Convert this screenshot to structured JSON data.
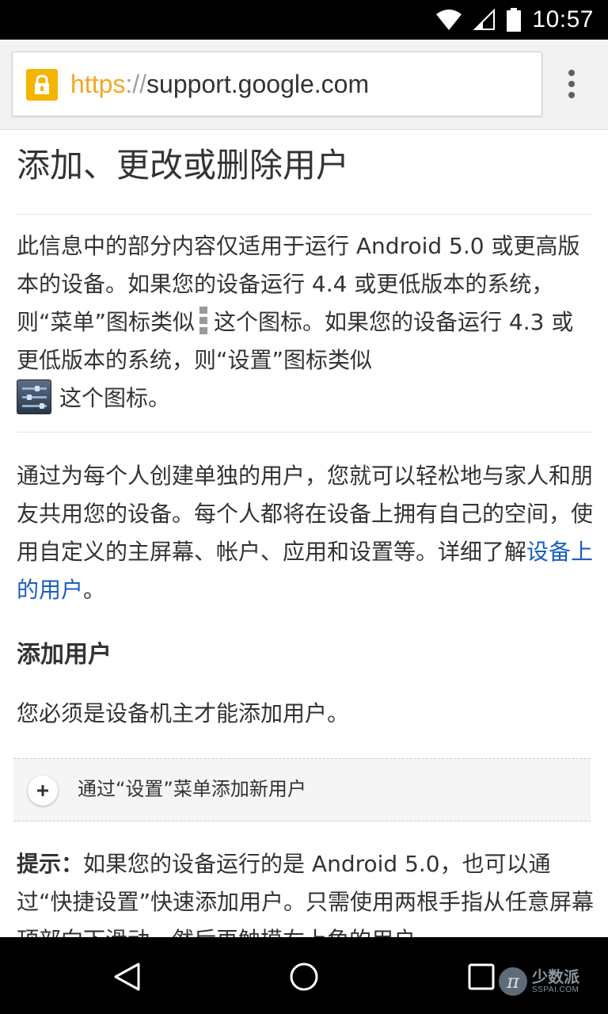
{
  "status_bar": {
    "time": "10:57",
    "icons": [
      "wifi-icon",
      "cell-signal-icon",
      "battery-icon"
    ]
  },
  "browser": {
    "url_scheme": "https",
    "url_separator": "://",
    "url_host": "support.google.com",
    "lock_icon": "lock-icon",
    "menu_icon": "overflow-menu-icon",
    "accent_color": "#f5b400"
  },
  "article": {
    "title": "添加、更改或删除用户",
    "note": {
      "part1": "此信息中的部分内容仅适用于运行 Android 5.0 或更高版本的设备。如果您的设备运行 4.4 或更低版本的系统，则“菜单”图标类似",
      "part2": "这个图标。如果您的设备运行 4.3 或更低版本的系统，则“设置”图标类似",
      "part3": "这个图标。",
      "menu_icon": "kebab-menu-icon",
      "settings_icon": "settings-sliders-icon"
    },
    "intro": {
      "text": "通过为每个人创建单独的用户，您就可以轻松地与家人和朋友共用您的设备。每个人都将在设备上拥有自己的空间，使用自定义的主屏幕、帐户、应用和设置等。详细了解",
      "link": "设备上的用户",
      "end": "。",
      "link_color": "#1a5ec2"
    },
    "add_user": {
      "heading": "添加用户",
      "body": "您必须是设备机主才能添加用户。",
      "expander_label": "通过“设置”菜单添加新用户",
      "expander_icon": "plus-icon"
    },
    "tip": {
      "label": "提示：",
      "text": "如果您的设备运行的是 Android 5.0，也可以通过“快捷设置”快速添加用户。只需使用两根手指从任意屏幕顶部向下滑动，然后再触摸右上角的用户"
    }
  },
  "nav_bar": {
    "back_icon": "back-icon",
    "home_icon": "home-icon",
    "recents_icon": "recents-icon",
    "watermark_logo": "π",
    "watermark_cn": "少数派",
    "watermark_en": "SSPAI.COM"
  }
}
